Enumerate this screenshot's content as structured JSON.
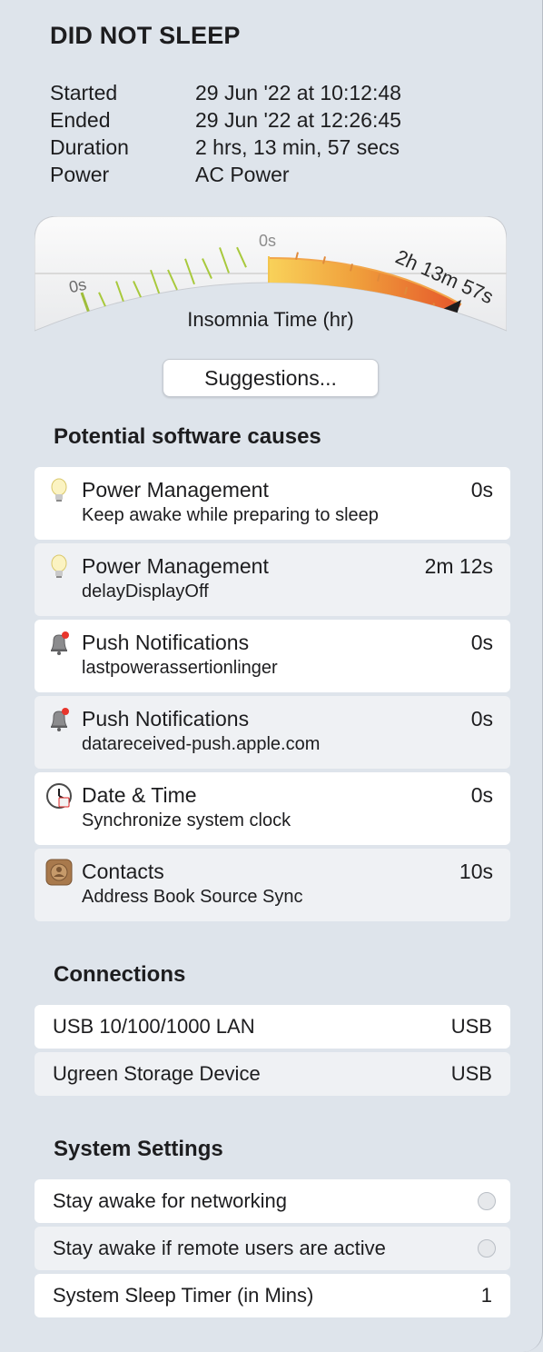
{
  "title": "DID NOT SLEEP",
  "info": [
    {
      "label": "Started",
      "value": "29 Jun '22 at 10:12:48"
    },
    {
      "label": "Ended",
      "value": "29 Jun '22 at 12:26:45"
    },
    {
      "label": "Duration",
      "value": "2 hrs, 13 min, 57 secs"
    },
    {
      "label": "Power",
      "value": "AC Power"
    }
  ],
  "gauge": {
    "left_label": "0s",
    "top_label": "0s",
    "value_label": "2h 13m 57s",
    "caption": "Insomnia Time (hr)",
    "accent_orange": "#e8592a",
    "accent_yellow": "#f7cc52",
    "tick_green": "#a8c93c"
  },
  "suggestions_label": "Suggestions...",
  "causes_heading": "Potential software causes",
  "causes": [
    {
      "icon": "lightbulb-icon",
      "name": "Power Management",
      "detail": "Keep awake while preparing to sleep",
      "time": "0s"
    },
    {
      "icon": "lightbulb-icon",
      "name": "Power Management",
      "detail": "delayDisplayOff",
      "time": "2m 12s"
    },
    {
      "icon": "bell-icon",
      "name": "Push Notifications",
      "detail": "lastpowerassertionlinger",
      "time": "0s"
    },
    {
      "icon": "bell-icon",
      "name": "Push Notifications",
      "detail": "datareceived-push.apple.com",
      "time": "0s"
    },
    {
      "icon": "clock-icon",
      "name": "Date & Time",
      "detail": "Synchronize system clock",
      "time": "0s"
    },
    {
      "icon": "contacts-icon",
      "name": "Contacts",
      "detail": "Address Book Source Sync",
      "time": "10s"
    }
  ],
  "connections_heading": "Connections",
  "connections": [
    {
      "name": "USB 10/100/1000 LAN",
      "type": "USB"
    },
    {
      "name": "Ugreen Storage Device",
      "type": "USB"
    }
  ],
  "settings_heading": "System Settings",
  "settings": [
    {
      "name": "Stay awake for networking",
      "value": ""
    },
    {
      "name": "Stay awake if remote users are active",
      "value": ""
    },
    {
      "name": "System Sleep Timer (in Mins)",
      "value": "1"
    }
  ]
}
